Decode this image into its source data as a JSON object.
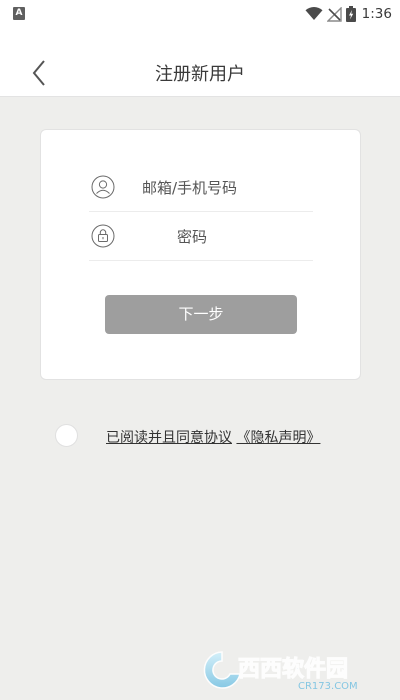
{
  "status_bar": {
    "app_icon_letter": "A",
    "time": "1:36",
    "icons": [
      "wifi-icon",
      "no-signal-icon",
      "battery-charging-icon"
    ]
  },
  "header": {
    "title": "注册新用户",
    "back_icon": "chevron-left-icon"
  },
  "form": {
    "email_placeholder": "邮箱/手机号码",
    "email_value": "",
    "email_icon": "user-icon",
    "password_placeholder": "密码",
    "password_value": "",
    "password_icon": "lock-icon",
    "next_label": "下一步",
    "next_button_color": "#9e9e9e"
  },
  "agreement": {
    "checked": false,
    "text_prefix": "已阅读并且同意协议",
    "privacy_link": "《隐私声明》"
  },
  "watermark": {
    "brand": "西西软件园",
    "site": "CR173.COM"
  }
}
